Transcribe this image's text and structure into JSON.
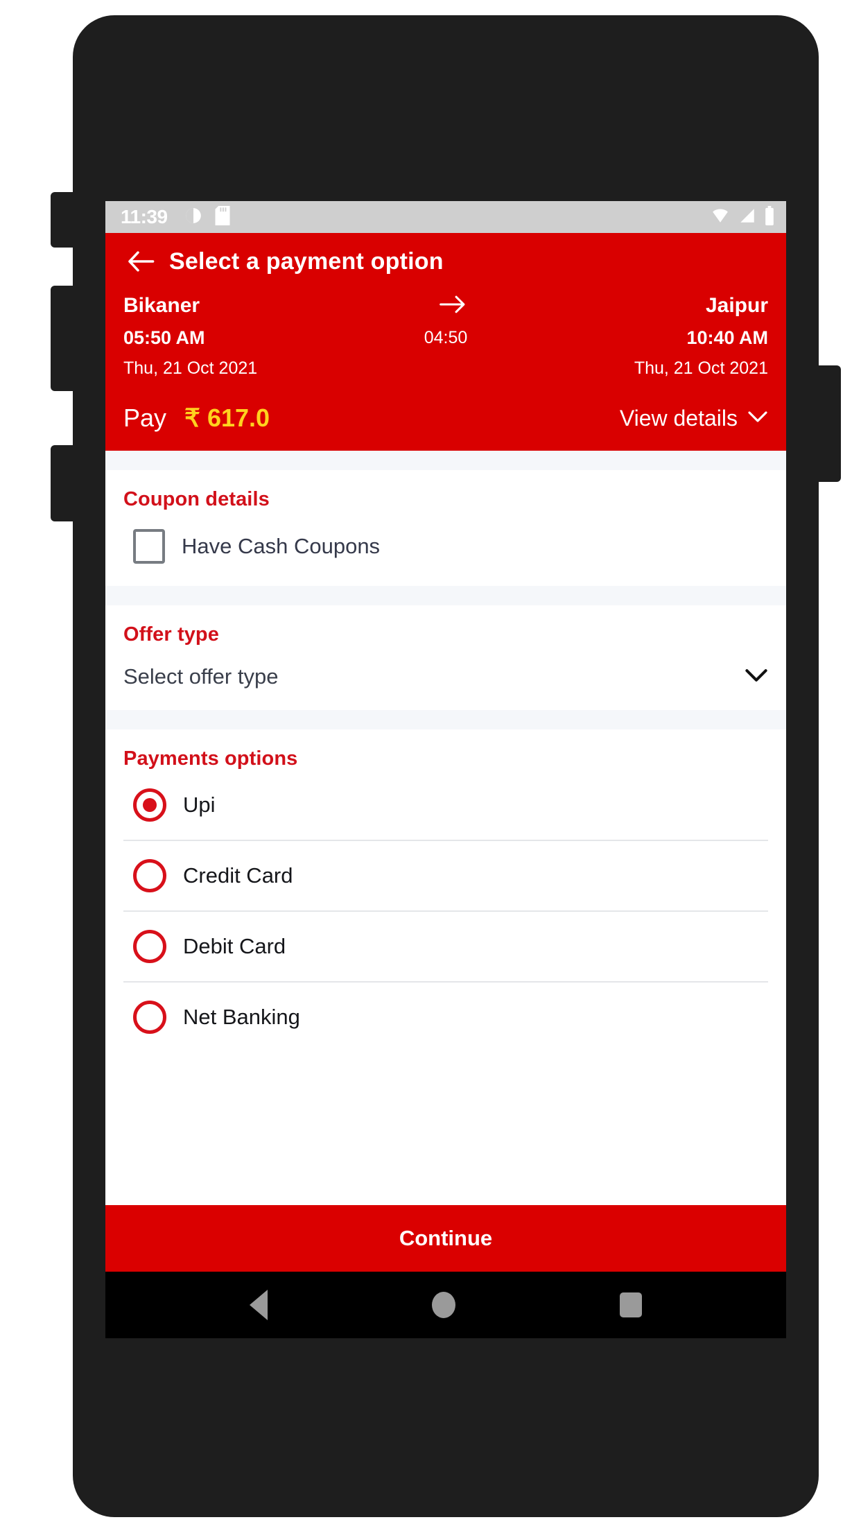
{
  "theme": {
    "brand_red": "#d90000",
    "accent_gold": "#ffd21f",
    "heading_red": "#d2101a",
    "frame_dark": "#1e1e1e",
    "band_gray": "#f5f7fa"
  },
  "status_bar": {
    "time": "11:39",
    "left_icons": [
      "alarm-icon",
      "sd-card-icon"
    ],
    "right_icons": [
      "wifi-icon",
      "signal-icon",
      "battery-icon"
    ]
  },
  "app_bar": {
    "back_icon": "arrow-left-icon",
    "title": "Select a payment option"
  },
  "journey": {
    "from_city": "Bikaner",
    "to_city": "Jaipur",
    "arrow_icon": "arrow-right-icon",
    "departure_time": "05:50 AM",
    "duration": "04:50",
    "arrival_time": "10:40 AM",
    "departure_date": "Thu, 21 Oct 2021",
    "arrival_date": "Thu, 21 Oct 2021"
  },
  "pay_row": {
    "label": "Pay",
    "amount": "₹ 617.0",
    "view_details_label": "View details",
    "view_details_icon": "chevron-down-icon"
  },
  "coupon": {
    "title": "Coupon details",
    "checkbox_label": "Have Cash Coupons",
    "checked": false
  },
  "offer": {
    "title": "Offer type",
    "selected_value": "Select offer type",
    "chevron_icon": "chevron-down-icon"
  },
  "payments": {
    "title": "Payments options",
    "options": [
      {
        "label": "Upi",
        "selected": true
      },
      {
        "label": "Credit Card",
        "selected": false
      },
      {
        "label": "Debit Card",
        "selected": false
      },
      {
        "label": "Net Banking",
        "selected": false
      }
    ]
  },
  "continue_button": {
    "label": "Continue"
  },
  "nav_bar": {
    "back_icon": "nav-back-triangle-icon",
    "home_icon": "nav-home-circle-icon",
    "recents_icon": "nav-recents-square-icon"
  }
}
